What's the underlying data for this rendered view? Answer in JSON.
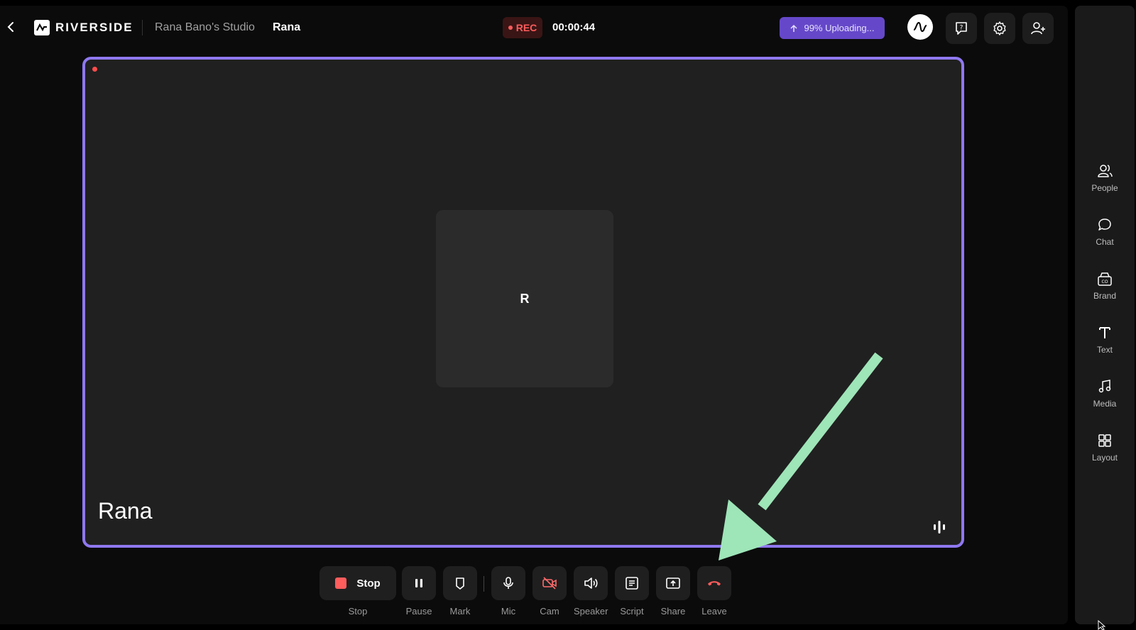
{
  "app": {
    "brand": "RIVERSIDE",
    "studio": "Rana Bano's Studio",
    "user": "Rana"
  },
  "recording": {
    "badge": "REC",
    "timer": "00:00:44",
    "upload_status": "99% Uploading..."
  },
  "stage": {
    "avatar_initial": "R",
    "participant_name": "Rana"
  },
  "controls": {
    "stop_button": "Stop",
    "stop": "Stop",
    "pause": "Pause",
    "mark": "Mark",
    "mic": "Mic",
    "cam": "Cam",
    "speaker": "Speaker",
    "script": "Script",
    "share": "Share",
    "leave": "Leave"
  },
  "sidebar": {
    "items": [
      {
        "label": "People",
        "icon": "people-icon"
      },
      {
        "label": "Chat",
        "icon": "chat-icon"
      },
      {
        "label": "Brand",
        "icon": "brand-icon"
      },
      {
        "label": "Text",
        "icon": "text-icon"
      },
      {
        "label": "Media",
        "icon": "music-note-icon"
      },
      {
        "label": "Layout",
        "icon": "grid-icon"
      }
    ]
  },
  "colors": {
    "accent": "#8f78f0",
    "upload_bg": "#6548c9",
    "rec_red": "#ff5c5c",
    "annotation_arrow": "#9ee5b8"
  }
}
